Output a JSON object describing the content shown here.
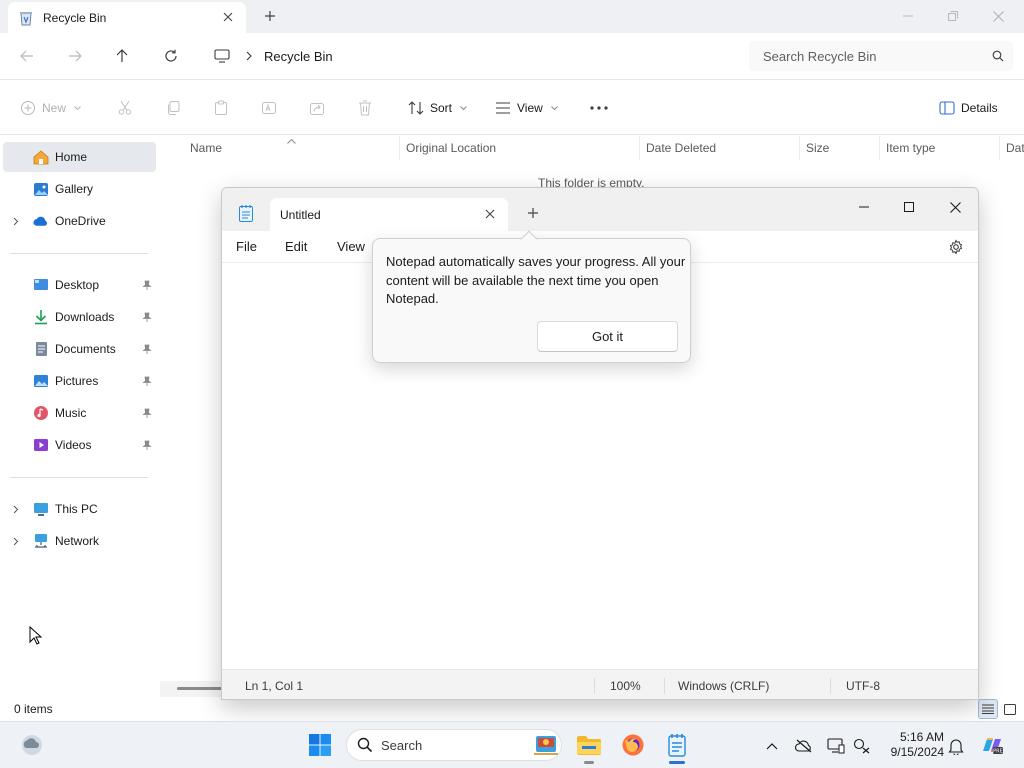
{
  "explorer": {
    "tab_title": "Recycle Bin",
    "breadcrumb": {
      "location": "Recycle Bin"
    },
    "search": {
      "placeholder": "Search Recycle Bin"
    },
    "toolbar": {
      "new_label": "New",
      "sort_label": "Sort",
      "view_label": "View",
      "details_label": "Details"
    },
    "nav": {
      "home": "Home",
      "gallery": "Gallery",
      "onedrive": "OneDrive",
      "quick_access": [
        {
          "label": "Desktop",
          "icon": "desktop-icon"
        },
        {
          "label": "Downloads",
          "icon": "download-icon"
        },
        {
          "label": "Documents",
          "icon": "document-icon"
        },
        {
          "label": "Pictures",
          "icon": "pictures-icon"
        },
        {
          "label": "Music",
          "icon": "music-icon"
        },
        {
          "label": "Videos",
          "icon": "videos-icon"
        }
      ],
      "this_pc": "This PC",
      "network": "Network"
    },
    "columns": [
      "Name",
      "Original Location",
      "Date Deleted",
      "Size",
      "Item type",
      "Dat"
    ],
    "empty_message": "This folder is empty.",
    "status": {
      "items_count": "0 items"
    }
  },
  "notepad": {
    "tab_title": "Untitled",
    "menu": {
      "file": "File",
      "edit": "Edit",
      "view": "View"
    },
    "flyout": {
      "message": "Notepad automatically saves your progress. All your content will be available the next time you open Notepad.",
      "button": "Got it"
    },
    "status": {
      "position": "Ln 1, Col 1",
      "zoom": "100%",
      "line_ending": "Windows (CRLF)",
      "encoding": "UTF-8"
    }
  },
  "taskbar": {
    "search_label": "Search",
    "clock": {
      "time": "5:16 AM",
      "date": "9/15/2024"
    }
  },
  "colors": {
    "accent": "#2f6ed6",
    "folder_yellow": "#f2b92c",
    "onedrive_blue": "#1c6fd6"
  }
}
